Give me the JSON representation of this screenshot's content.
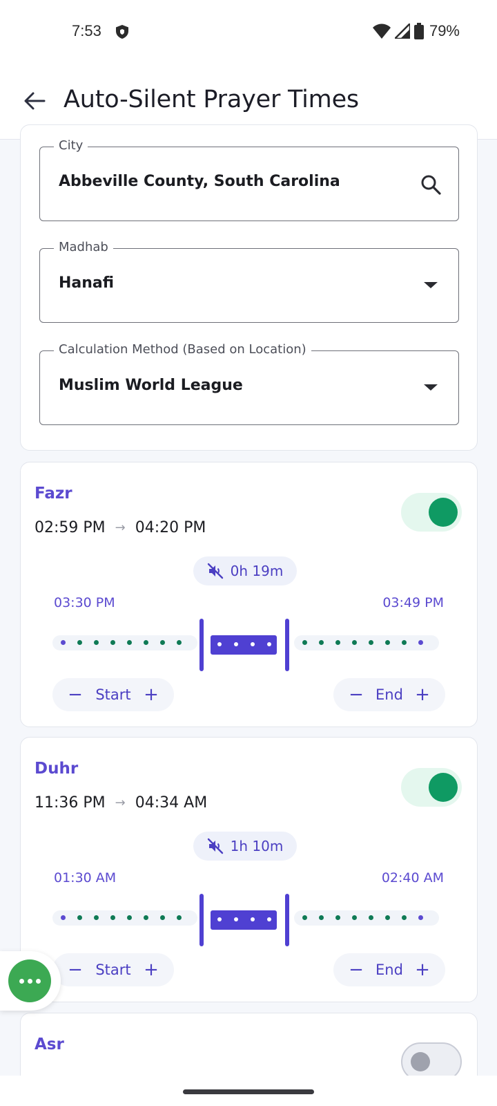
{
  "status": {
    "time": "7:53",
    "battery": "79%"
  },
  "appbar": {
    "title": "Auto-Silent Prayer Times"
  },
  "settings": {
    "city": {
      "label": "City",
      "value": "Abbeville County, South Carolina"
    },
    "madhab": {
      "label": "Madhab",
      "value": "Hanafi"
    },
    "method": {
      "label": "Calculation Method (Based on Location)",
      "value": "Muslim World League"
    }
  },
  "prayers": [
    {
      "name": "Fazr",
      "start_time": "02:59 PM",
      "end_time": "04:20 PM",
      "enabled": true,
      "duration": "0h 19m",
      "silent_start": "03:30 PM",
      "silent_end": "03:49 PM",
      "start_label": "Start",
      "end_label": "End"
    },
    {
      "name": "Duhr",
      "start_time": "11:36 PM",
      "end_time": "04:34 AM",
      "enabled": true,
      "duration": "1h 10m",
      "silent_start": "01:30 AM",
      "silent_end": "02:40 AM",
      "start_label": "Start",
      "end_label": "End"
    },
    {
      "name": "Asr",
      "enabled": false
    }
  ],
  "steppers": {
    "minus": "−",
    "plus": "+"
  },
  "arrow": "→",
  "colors": {
    "accent": "#5b4ad0",
    "toggle_on": "#0f9a63",
    "fab": "#3ca953"
  },
  "icons": {
    "back": "arrow-left-icon",
    "search": "search-icon",
    "dropdown": "caret-down-icon",
    "muted": "volume-off-icon",
    "fab": "more-horizontal-icon"
  }
}
